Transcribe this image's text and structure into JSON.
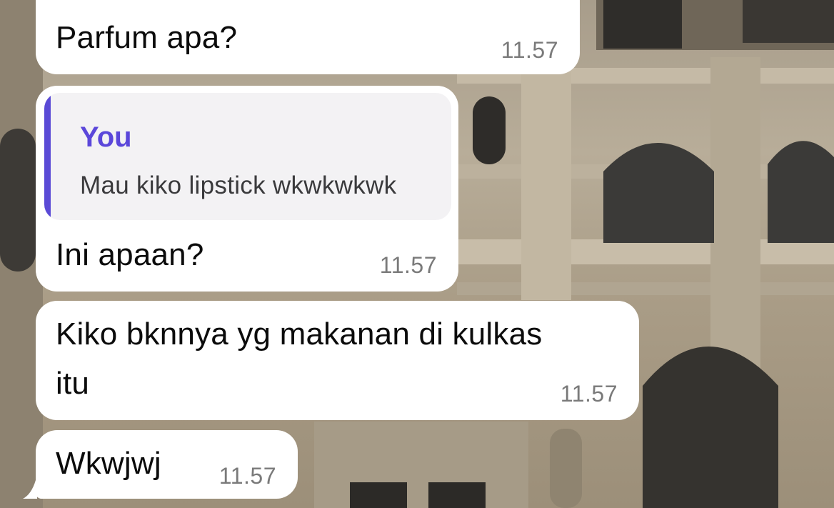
{
  "wallpaper": {
    "description_icon": "church-wallpaper"
  },
  "colors": {
    "bubble_bg": "#ffffff",
    "quote_bg": "#f3f2f4",
    "quote_accent": "#5a4ad6",
    "time_text": "#7a7a7a"
  },
  "messages": [
    {
      "text": "Parfum apa?",
      "time": "11.57"
    },
    {
      "reply_to": {
        "author": "You",
        "text": "Mau kiko lipstick wkwkwkwk"
      },
      "text": "Ini apaan?",
      "time": "11.57"
    },
    {
      "text_line1": "Kiko bknnya yg makanan di kulkas",
      "text_line2": "itu",
      "time": "11.57"
    },
    {
      "text": "Wkwjwj",
      "time": "11.57"
    }
  ]
}
